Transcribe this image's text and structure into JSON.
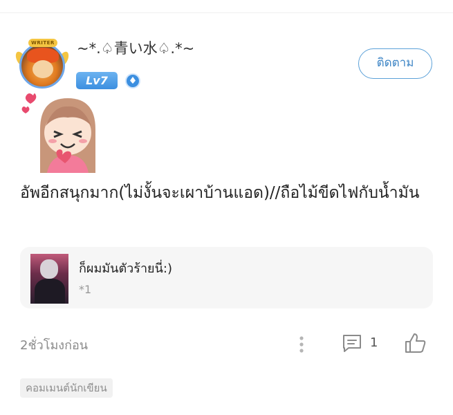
{
  "author": {
    "username": "~*.♤青い水♤.*~",
    "level": "Lv7",
    "writer_badge": "WRITER"
  },
  "follow_button": {
    "label": "ติดตาม"
  },
  "post": {
    "text": "อัพอีกสนุกมาก(ไม่งั้นจะเผาบ้านแอด)//ถือไม้ขีดไฟกับน้ำมัน"
  },
  "quote": {
    "text": "ก็ผมมันตัวร้ายนี่:)",
    "count": "*1"
  },
  "footer": {
    "timestamp": "2ชั่วโมงก่อน",
    "comment_count": "1",
    "tag": "คอมเมนต์นักเขียน"
  },
  "colors": {
    "accent": "#3f86c6",
    "level_badge": "#3c8fe0",
    "muted": "#8a8a8a"
  },
  "icons": [
    "verified-icon",
    "more-vertical-icon",
    "comment-icon",
    "thumbs-up-icon"
  ]
}
